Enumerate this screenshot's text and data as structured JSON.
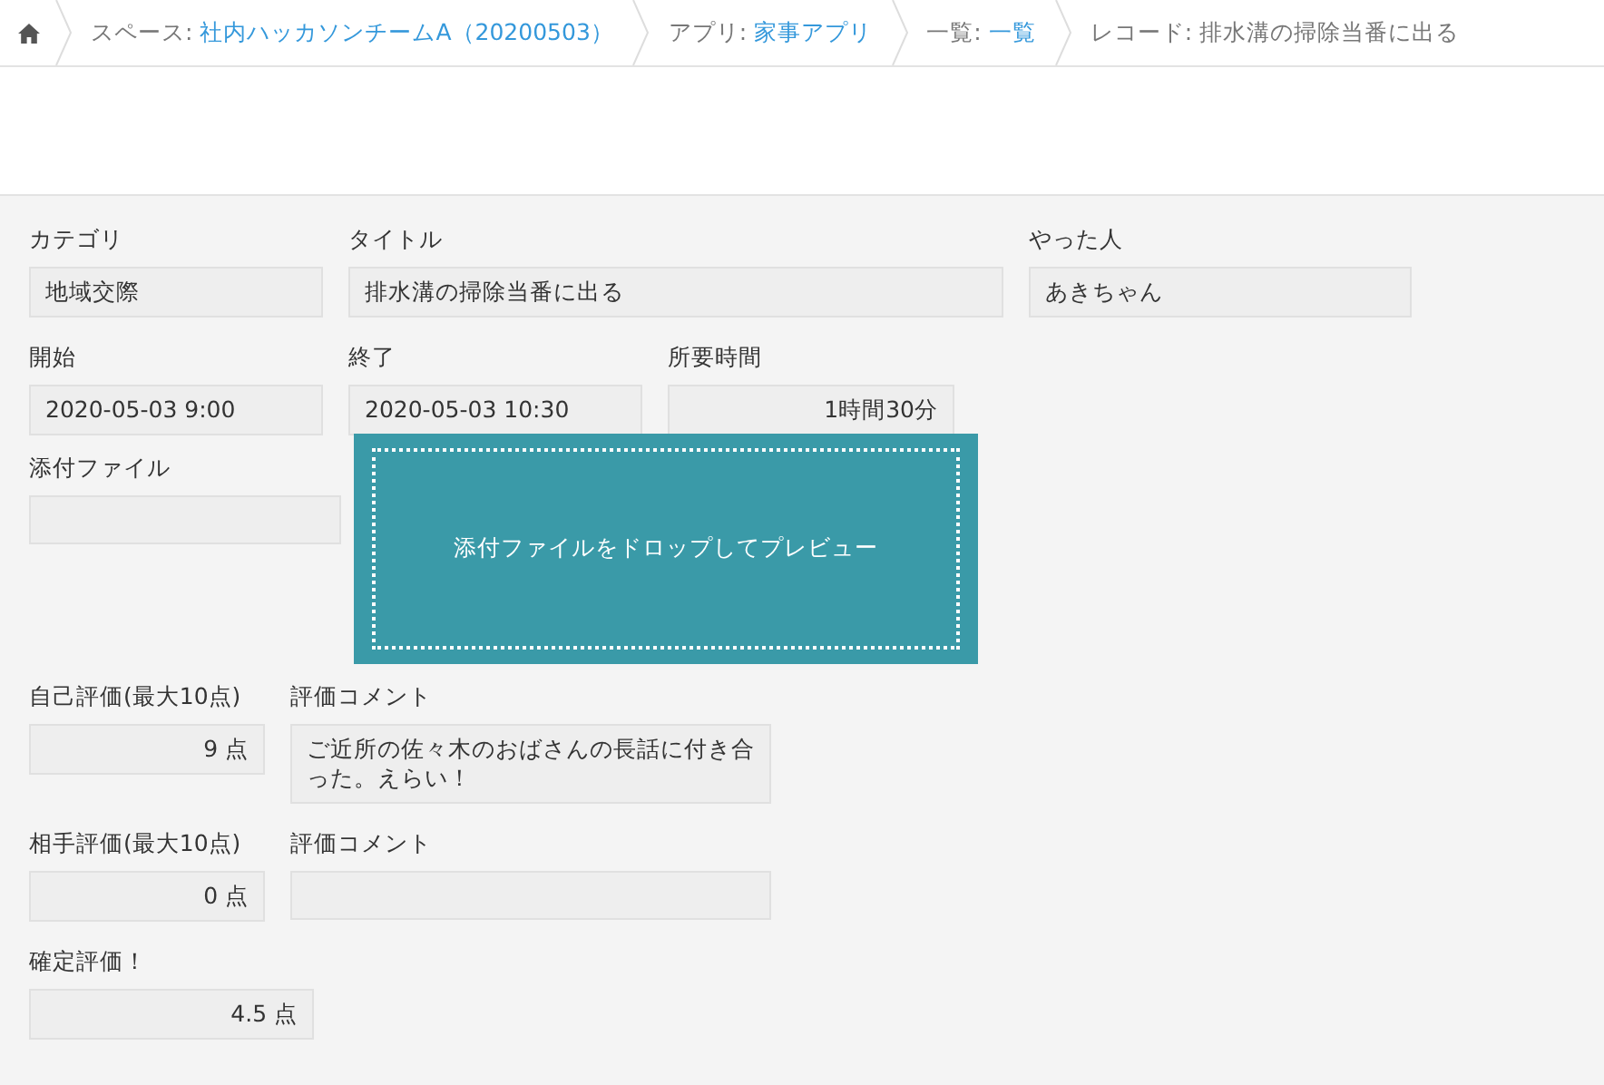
{
  "breadcrumb": [
    {
      "kind": "home"
    },
    {
      "kind": "link",
      "prefix": "スペース:",
      "link": "社内ハッカソンチームA（20200503）"
    },
    {
      "kind": "link",
      "prefix": "アプリ:",
      "link": "家事アプリ"
    },
    {
      "kind": "link",
      "prefix": "一覧:",
      "link": "一覧"
    },
    {
      "kind": "current",
      "text": "レコード: 排水溝の掃除当番に出る"
    }
  ],
  "rows": [
    [
      {
        "kind": "text",
        "label": "カテゴリ",
        "value": "地域交際"
      },
      {
        "kind": "text",
        "label": "タイトル",
        "value": "排水溝の掃除当番に出る"
      },
      {
        "kind": "text",
        "label": "やった人",
        "value": "あきちゃん"
      }
    ],
    [
      {
        "kind": "text",
        "label": "開始",
        "value": "2020-05-03 9:00"
      },
      {
        "kind": "text",
        "label": "終了",
        "value": "2020-05-03 10:30"
      },
      {
        "kind": "number",
        "label": "所要時間",
        "value": "1時間30分"
      }
    ],
    [
      {
        "kind": "text",
        "label": "添付ファイル"
      },
      {
        "kind": "dropzone",
        "text": "添付ファイルをドロップしてプレビュー"
      }
    ],
    [
      {
        "kind": "number",
        "label": "自己評価(最大10点)",
        "value": "9 点"
      },
      {
        "kind": "text",
        "label": "評価コメント",
        "value": "ご近所の佐々木のおばさんの長話に付き合った。えらい！"
      }
    ],
    [
      {
        "kind": "number",
        "label": "相手評価(最大10点)",
        "value": "0 点"
      },
      {
        "kind": "text",
        "label": "評価コメント"
      }
    ],
    [
      {
        "kind": "number",
        "label": "確定評価！",
        "value": "4.5 点"
      }
    ]
  ]
}
